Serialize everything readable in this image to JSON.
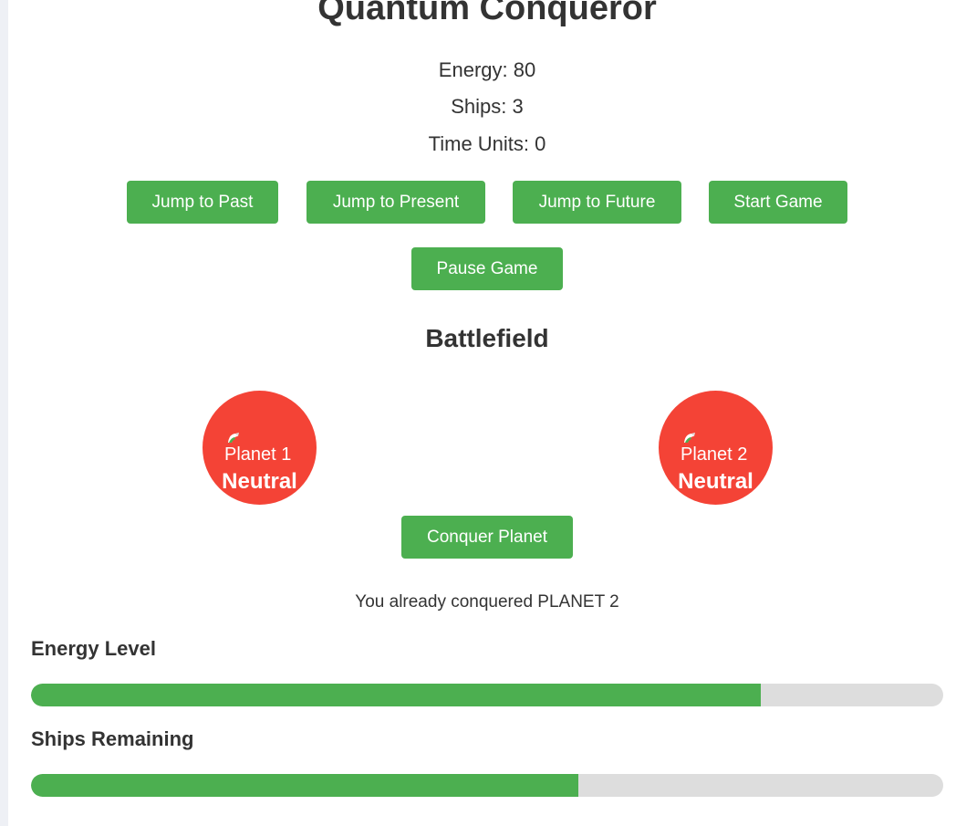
{
  "game": {
    "title": "Quantum Conqueror",
    "stats": {
      "energy_label": "Energy: 80",
      "ships_label": "Ships: 3",
      "time_label": "Time Units: 0"
    },
    "controls": {
      "jump_past": "Jump to Past",
      "jump_present": "Jump to Present",
      "jump_future": "Jump to Future",
      "start_game": "Start Game",
      "pause_game": "Pause Game"
    }
  },
  "battlefield": {
    "title": "Battlefield",
    "planets": [
      {
        "alt": "Planet 1",
        "status": "Neutral",
        "color": "#f44336"
      },
      {
        "alt": "Planet 2",
        "status": "Neutral",
        "color": "#f44336"
      }
    ],
    "conquer_label": "Conquer Planet",
    "message": "You already conquered PLANET 2"
  },
  "meters": {
    "energy": {
      "label": "Energy Level",
      "percent": 80
    },
    "ships": {
      "label": "Ships Remaining",
      "percent": 60
    }
  },
  "colors": {
    "accent": "#4caf50",
    "planet": "#f44336",
    "track": "#dddddd"
  }
}
